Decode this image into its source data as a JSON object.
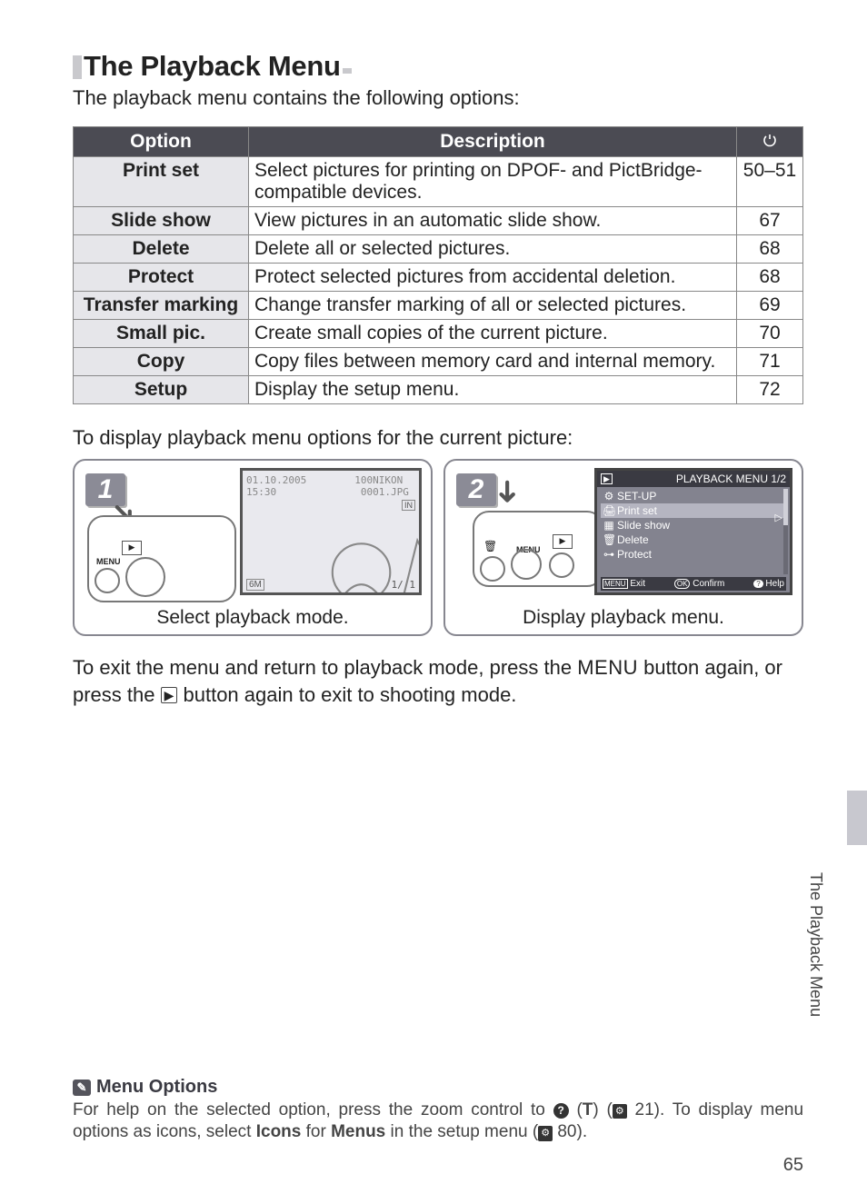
{
  "title": "The Playback Menu",
  "lead": "The playback menu contains the following options:",
  "table": {
    "headers": {
      "option": "Option",
      "description": "Description",
      "ref_icon": "⚙"
    },
    "rows": [
      {
        "option": "Print set",
        "description": "Select pictures for printing on DPOF- and PictBridge-compatible devices.",
        "page": "50–51"
      },
      {
        "option": "Slide show",
        "description": "View pictures in an automatic slide show.",
        "page": "67"
      },
      {
        "option": "Delete",
        "description": "Delete all or selected pictures.",
        "page": "68"
      },
      {
        "option": "Protect",
        "description": "Protect selected pictures from accidental deletion.",
        "page": "68"
      },
      {
        "option": "Transfer marking",
        "description": "Change transfer marking of all or selected pictures.",
        "page": "69"
      },
      {
        "option": "Small pic.",
        "description": "Create small copies of the current picture.",
        "page": "70"
      },
      {
        "option": "Copy",
        "description": "Copy files between memory card and internal memory.",
        "page": "71"
      },
      {
        "option": "Setup",
        "description": "Display the setup menu.",
        "page": "72"
      }
    ]
  },
  "mid_text": "To display playback menu options for the current picture:",
  "steps": {
    "s1": {
      "num": "1",
      "caption": "Select playback mode.",
      "screen": {
        "date": "01.10.2005",
        "time": "15:30",
        "folder": "100NIKON",
        "file": "0001.JPG",
        "in_label": "IN",
        "size": "6M",
        "frame": "1/   1"
      },
      "camera_label": "MENU"
    },
    "s2": {
      "num": "2",
      "caption": "Display playback menu.",
      "camera_label": "MENU",
      "menu": {
        "title": "PLAYBACK MENU  1/2",
        "items": [
          {
            "icon": "⚙",
            "label": "SET-UP"
          },
          {
            "icon": "🖨",
            "label": "Print set",
            "selected": true
          },
          {
            "icon": "▦",
            "label": "Slide show"
          },
          {
            "icon": "🗑",
            "label": "Delete"
          },
          {
            "icon": "⊶",
            "label": "Protect"
          }
        ],
        "footer": {
          "exit": "Exit",
          "exit_icon": "MENU",
          "confirm": "Confirm",
          "confirm_icon": "OK",
          "help": "Help",
          "help_icon": "?"
        }
      }
    }
  },
  "after_text": {
    "pre": "To exit the menu and return to playback mode, press the ",
    "menu_word": "MENU",
    "mid1": " button again, or press the ",
    "play_icon": "▶",
    "post": " button again to exit to shooting mode."
  },
  "side_label": "The Playback Menu",
  "footer": {
    "icon": "🔍",
    "title": "Menu Options",
    "text_parts": {
      "a": "For help on the selected option, press the zoom control to ",
      "q": "?",
      "b": " (",
      "t": "T",
      "c": ") (",
      "ref1_icon": "⚙",
      "ref1": " 21).  To display menu options as icons, select ",
      "icons_word": "Icons",
      "for_word": " for ",
      "menus_word": "Menus",
      "d": " in the setup menu (",
      "ref2_icon": "⚙",
      "ref2": " 80)."
    }
  },
  "page_number": "65"
}
